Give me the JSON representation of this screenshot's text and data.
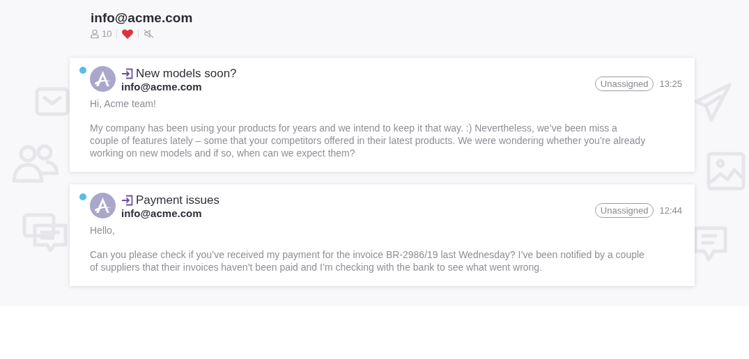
{
  "header": {
    "title": "info@acme.com",
    "followers": "10",
    "favorite": true,
    "muted": true
  },
  "messages": [
    {
      "unread": true,
      "subject": "New models soon?",
      "sender": "info@acme.com",
      "status": "Unassigned",
      "time": "13:25",
      "greeting": "Hi, Acme team!",
      "body": "My company has been using your products for years and we intend to keep it that way. :) Nevertheless, we’ve been miss a couple of features lately – some that your competitors offered in their latest products. We were wondering whether you’re already working on new models and if so, when can we expect them?"
    },
    {
      "unread": true,
      "subject": "Payment issues",
      "sender": "info@acme.com",
      "status": "Unassigned",
      "time": "12:44",
      "greeting": "Hello,",
      "body": "Can you please check if you’ve received my payment for the invoice BR-2986/19 last Wednesday? I’ve been notified by a couple of suppliers that their invoices haven’t been paid and I’m checking with the bank to see what went wrong."
    }
  ]
}
